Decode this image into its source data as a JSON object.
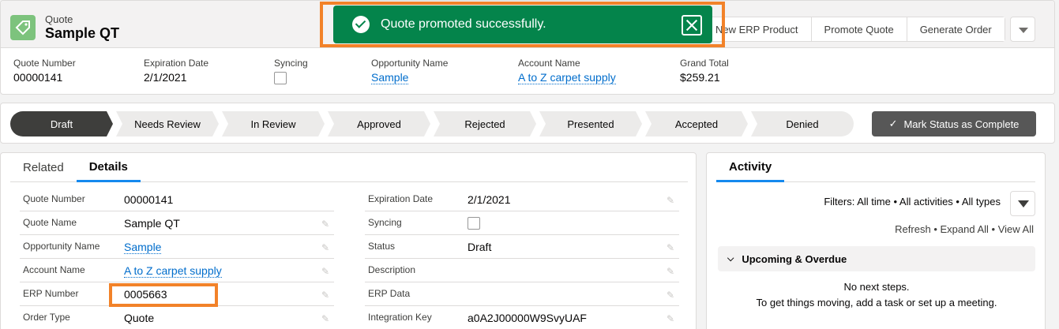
{
  "header": {
    "object_type": "Quote",
    "record_name": "Sample QT",
    "icon": "quote-tag-icon",
    "icon_color": "#7dc37d",
    "actions": [
      "New ERP Product",
      "Promote Quote",
      "Generate Order"
    ],
    "fields": [
      {
        "label": "Quote Number",
        "value": "00000141"
      },
      {
        "label": "Expiration Date",
        "value": "2/1/2021"
      },
      {
        "label": "Syncing",
        "value": ""
      },
      {
        "label": "Opportunity Name",
        "value": "Sample"
      },
      {
        "label": "Account Name",
        "value": "A to Z carpet supply"
      },
      {
        "label": "Grand Total",
        "value": "$259.21"
      }
    ]
  },
  "toast": {
    "message": "Quote promoted successfully.",
    "color": "#04844b"
  },
  "path": {
    "steps": [
      "Draft",
      "Needs Review",
      "In Review",
      "Approved",
      "Rejected",
      "Presented",
      "Accepted",
      "Denied"
    ],
    "active_step": "Draft",
    "mark_button": "Mark Status as Complete"
  },
  "details": {
    "tabs": [
      "Related",
      "Details"
    ],
    "active_tab": "Details",
    "left": [
      {
        "label": "Quote Number",
        "value": "00000141"
      },
      {
        "label": "Quote Name",
        "value": "Sample QT"
      },
      {
        "label": "Opportunity Name",
        "value": "Sample"
      },
      {
        "label": "Account Name",
        "value": "A to Z carpet supply"
      },
      {
        "label": "ERP Number",
        "value": "0005663"
      },
      {
        "label": "Order Type",
        "value": "Quote"
      }
    ],
    "right": [
      {
        "label": "Expiration Date",
        "value": "2/1/2021"
      },
      {
        "label": "Syncing",
        "value": ""
      },
      {
        "label": "Status",
        "value": "Draft"
      },
      {
        "label": "Description",
        "value": ""
      },
      {
        "label": "ERP Data",
        "value": ""
      },
      {
        "label": "Integration Key",
        "value": "a0A2J00000W9SvyUAF"
      }
    ]
  },
  "activity": {
    "tab": "Activity",
    "filters": "Filters: All time • All activities • All types",
    "refresh": "Refresh",
    "expand_all": "Expand All",
    "view_all": "View All",
    "upcoming": "Upcoming & Overdue",
    "no_steps": "No next steps.",
    "hint": "To get things moving, add a task or set up a meeting."
  },
  "highlight_color": "#f28229"
}
